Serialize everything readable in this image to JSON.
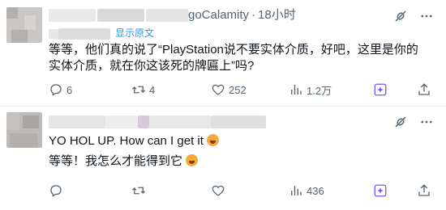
{
  "tweet1": {
    "author_suffix": "goCalamity",
    "separator": "·",
    "time": "18小时",
    "translate_label": "显示原文",
    "text": "等等，他们真的说了“PlayStation说不要实体介质，好吧，这里是你的实体介质，就在你这该死的牌匾上”吗?",
    "replies": "6",
    "retweets": "4",
    "likes": "252",
    "views": "1.2万"
  },
  "tweet2": {
    "line1": "YO HOL UP. How can I get it",
    "line2": "等等！我怎么才能得到它",
    "replies": "",
    "retweets": "",
    "likes": "",
    "views": "436"
  },
  "colors": {
    "secondary_text": "#536471",
    "link": "#1d9bf0",
    "grok_accent": "#7856ff",
    "divider": "#e6ecf0"
  },
  "icons": [
    "reply-icon",
    "retweet-icon",
    "like-icon",
    "views-icon",
    "grok-icon",
    "share-icon",
    "grok-logo-icon",
    "more-icon"
  ]
}
